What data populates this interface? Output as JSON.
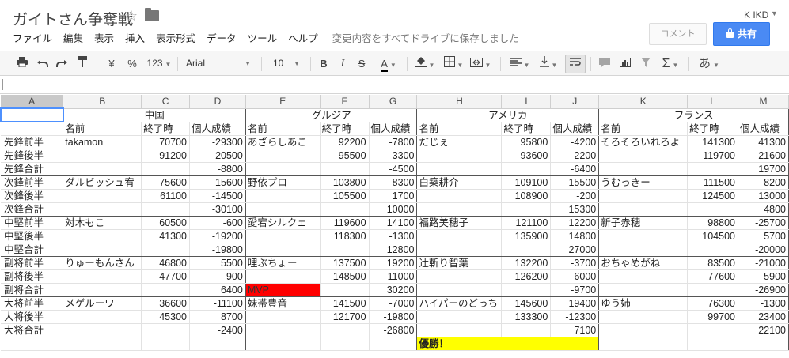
{
  "app": {
    "title": "ガイトさん争奪戦",
    "user": "K IKD",
    "comment_label": "コメント",
    "share_label": "共有",
    "save_status": "変更内容をすべてドライブに保存しました"
  },
  "menu": [
    "ファイル",
    "編集",
    "表示",
    "挿入",
    "表示形式",
    "データ",
    "ツール",
    "ヘルプ"
  ],
  "toolbar": {
    "currency": "¥",
    "percent": "%",
    "number_format": "123",
    "font": "Arial",
    "font_size": "10",
    "bold": "B",
    "italic": "I",
    "strike": "S",
    "text_color": "A",
    "functions": "Σ",
    "input_tools": "あ"
  },
  "sheet": {
    "columns": [
      "A",
      "B",
      "C",
      "D",
      "E",
      "F",
      "G",
      "H",
      "I",
      "J",
      "K",
      "L",
      "M"
    ],
    "groups": [
      "中国",
      "グルジア",
      "アメリカ",
      "フランス"
    ],
    "subheaders": [
      "名前",
      "終了時",
      "個人成績"
    ],
    "sections": [
      {
        "labels": [
          "先鋒前半",
          "先鋒後半",
          "先鋒合計"
        ],
        "teams": [
          {
            "name": "takamon",
            "t1": "70700",
            "s1": "-29300",
            "t2": "91200",
            "s2": "20500",
            "total": "-8800"
          },
          {
            "name": "あざらしあこ",
            "t1": "92200",
            "s1": "-7800",
            "t2": "95500",
            "s2": "3300",
            "total": "-4500"
          },
          {
            "name": "だじぇ",
            "t1": "95800",
            "s1": "-4200",
            "t2": "93600",
            "s2": "-2200",
            "total": "-6400"
          },
          {
            "name": "そろそろいれろよ",
            "t1": "141300",
            "s1": "41300",
            "t2": "119700",
            "s2": "-21600",
            "total": "19700"
          }
        ]
      },
      {
        "labels": [
          "次鋒前半",
          "次鋒後半",
          "次鋒合計"
        ],
        "teams": [
          {
            "name": "ダルビッシュ宥",
            "t1": "75600",
            "s1": "-15600",
            "t2": "61100",
            "s2": "-14500",
            "total": "-30100"
          },
          {
            "name": "野依プロ",
            "t1": "103800",
            "s1": "8300",
            "t2": "105500",
            "s2": "1700",
            "total": "10000"
          },
          {
            "name": "白築耕介",
            "t1": "109100",
            "s1": "15500",
            "t2": "108900",
            "s2": "-200",
            "total": "15300"
          },
          {
            "name": "うむっきー",
            "t1": "111500",
            "s1": "-8200",
            "t2": "124500",
            "s2": "13000",
            "total": "4800"
          }
        ]
      },
      {
        "labels": [
          "中堅前半",
          "中堅後半",
          "中堅合計"
        ],
        "teams": [
          {
            "name": "対木もこ",
            "t1": "60500",
            "s1": "-600",
            "t2": "41300",
            "s2": "-19200",
            "total": "-19800"
          },
          {
            "name": "愛宕シルクェ",
            "t1": "119600",
            "s1": "14100",
            "t2": "118300",
            "s2": "-1300",
            "total": "12800"
          },
          {
            "name": "福路美穂子",
            "t1": "121100",
            "s1": "12200",
            "t2": "135900",
            "s2": "14800",
            "total": "27000"
          },
          {
            "name": "新子赤穂",
            "t1": "98800",
            "s1": "-25700",
            "t2": "104500",
            "s2": "5700",
            "total": "-20000"
          }
        ]
      },
      {
        "labels": [
          "副将前半",
          "副将後半",
          "副将合計"
        ],
        "teams": [
          {
            "name": "りゅーもんさん",
            "t1": "46800",
            "s1": "5500",
            "t2": "47700",
            "s2": "900",
            "total": "6400"
          },
          {
            "name": "哩ぶちょー",
            "t1": "137500",
            "s1": "19200",
            "t2": "148500",
            "s2": "11000",
            "total": "30200",
            "note": "MVP"
          },
          {
            "name": "辻斬り智葉",
            "t1": "132200",
            "s1": "-3700",
            "t2": "126200",
            "s2": "-6000",
            "total": "-9700"
          },
          {
            "name": "おちゃめがね",
            "t1": "83500",
            "s1": "-21000",
            "t2": "77600",
            "s2": "-5900",
            "total": "-26900"
          }
        ]
      },
      {
        "labels": [
          "大将前半",
          "大将後半",
          "大将合計"
        ],
        "teams": [
          {
            "name": "メゲルーワ",
            "t1": "36600",
            "s1": "-11100",
            "t2": "45300",
            "s2": "8700",
            "total": "-2400"
          },
          {
            "name": "妹帯豊音",
            "t1": "141500",
            "s1": "-7000",
            "t2": "121700",
            "s2": "-19800",
            "total": "-26800"
          },
          {
            "name": "ハイパーのどっち",
            "t1": "145600",
            "s1": "19400",
            "t2": "133300",
            "s2": "-12300",
            "total": "7100"
          },
          {
            "name": "ゆう姉",
            "t1": "76300",
            "s1": "-1300",
            "t2": "99700",
            "s2": "23400",
            "total": "22100"
          }
        ]
      }
    ],
    "winner_label": "優勝！",
    "winner_team_index": 2
  },
  "colors": {
    "mvp": "#ff0000",
    "winner": "#ffff00",
    "share": "#4a8af4",
    "selection": "#4d90fe"
  }
}
